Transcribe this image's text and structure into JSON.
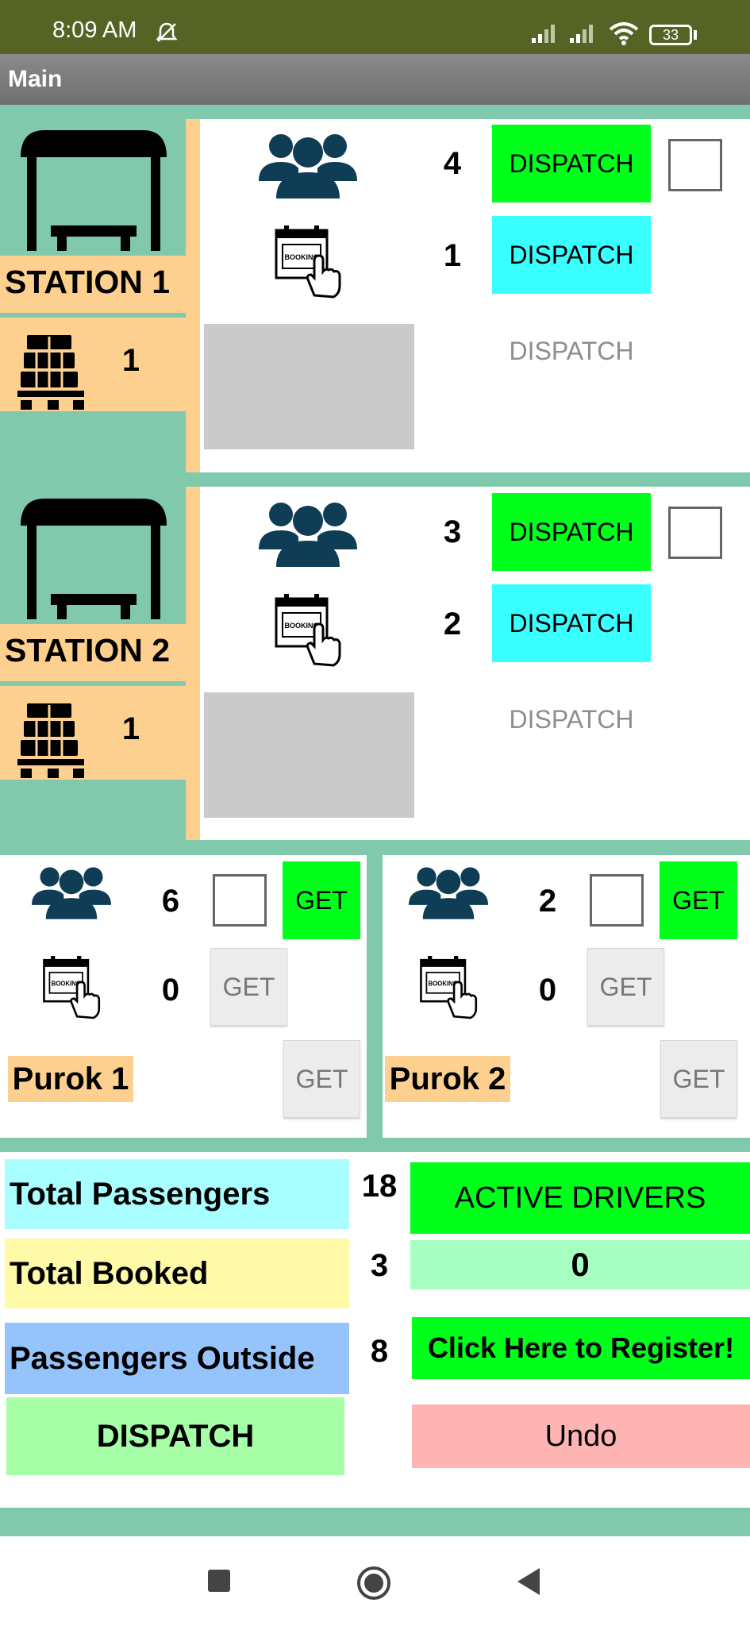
{
  "status_bar": {
    "time": "8:09 AM",
    "battery": "33"
  },
  "app": {
    "title": "Main"
  },
  "stations": [
    {
      "label": "STATION 1",
      "cargo_count": "1",
      "passengers": "4",
      "booked": "1",
      "dispatch_passengers": "DISPATCH",
      "dispatch_booked": "DISPATCH",
      "dispatch_disabled": "DISPATCH"
    },
    {
      "label": "STATION 2",
      "cargo_count": "1",
      "passengers": "3",
      "booked": "2",
      "dispatch_passengers": "DISPATCH",
      "dispatch_booked": "DISPATCH",
      "dispatch_disabled": "DISPATCH"
    }
  ],
  "puroks": [
    {
      "label": "Purok 1",
      "passengers": "6",
      "booked": "0",
      "get_passengers": "GET",
      "get_booked": "GET",
      "get_other": "GET"
    },
    {
      "label": "Purok 2",
      "passengers": "2",
      "booked": "0",
      "get_passengers": "GET",
      "get_booked": "GET",
      "get_other": "GET"
    }
  ],
  "booking_icon_text": "BOOKING",
  "summary": {
    "total_passengers_label": "Total Passengers",
    "total_passengers": "18",
    "total_booked_label": "Total Booked",
    "total_booked": "3",
    "passengers_outside_label": "Passengers Outside",
    "passengers_outside": "8",
    "dispatch_label": "DISPATCH",
    "active_drivers_label": "ACTIVE DRIVERS",
    "active_drivers": "0",
    "register_label": "Click Here to Register!",
    "undo_label": "Undo"
  },
  "colors": {
    "status_bar": "#556424",
    "teal": "#80c9ac",
    "peach": "#fdd08f",
    "green": "#00ff1b",
    "cyan": "#39ffff"
  }
}
